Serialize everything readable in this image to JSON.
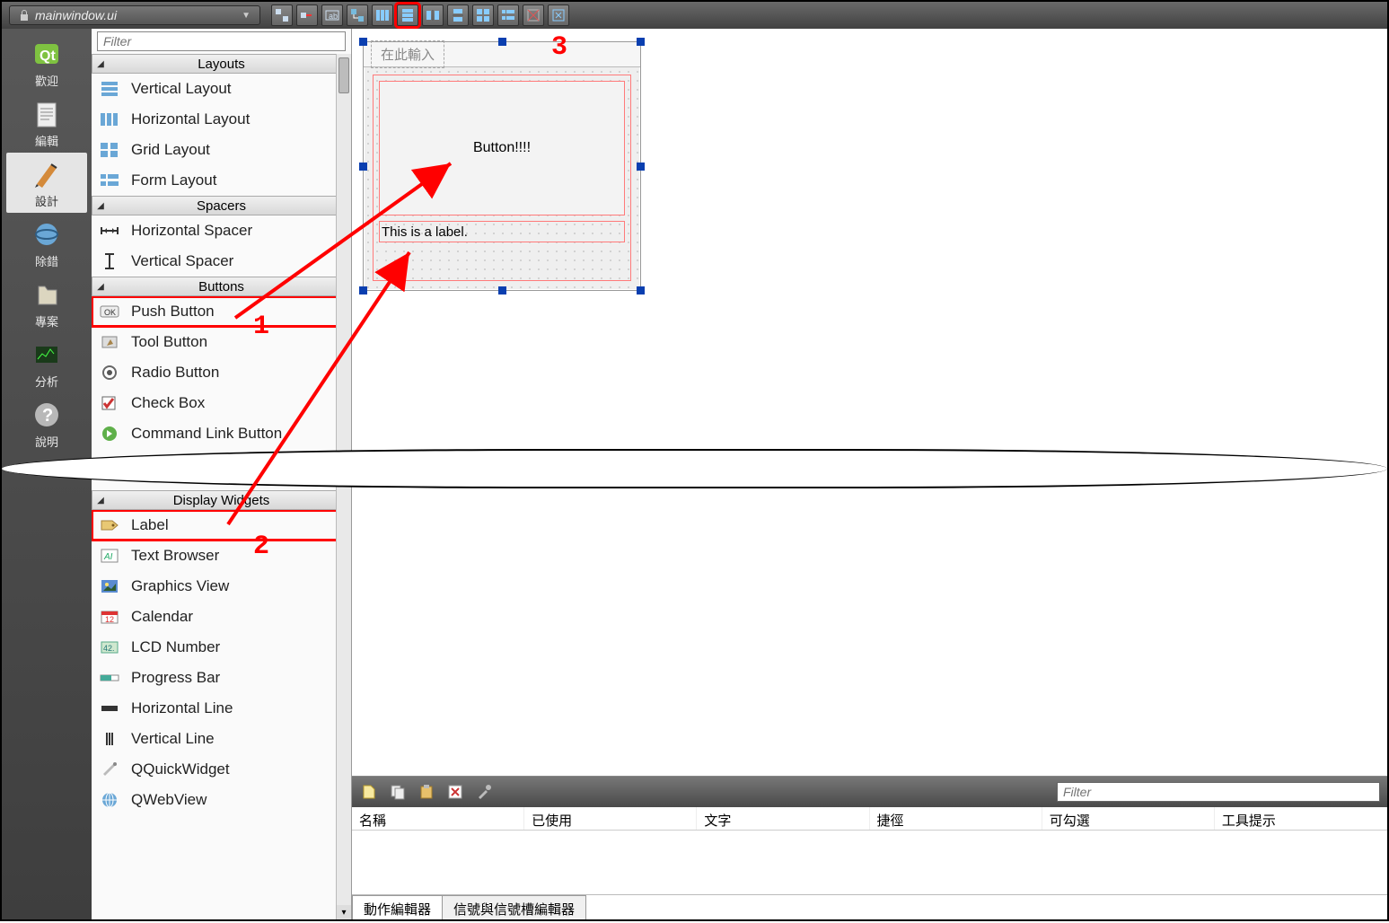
{
  "toolbar": {
    "filename": "mainwindow.ui",
    "buttons": [
      "edit-widgets",
      "edit-signals",
      "edit-buddies",
      "edit-tab-order",
      "layout-h",
      "layout-v",
      "layout-h-splitter",
      "layout-v-splitter",
      "layout-grid",
      "layout-form",
      "break-layout",
      "adjust-size"
    ]
  },
  "modes": [
    {
      "key": "welcome",
      "label": "歡迎"
    },
    {
      "key": "edit",
      "label": "編輯"
    },
    {
      "key": "design",
      "label": "設計",
      "active": true
    },
    {
      "key": "debug",
      "label": "除錯"
    },
    {
      "key": "projects",
      "label": "專案"
    },
    {
      "key": "analyze",
      "label": "分析"
    },
    {
      "key": "help",
      "label": "說明"
    }
  ],
  "widgetbox": {
    "filter_placeholder": "Filter",
    "groups_top": [
      {
        "title": "Layouts",
        "arrow": "◢",
        "items": [
          {
            "icon": "vlayout",
            "label": "Vertical Layout"
          },
          {
            "icon": "hlayout",
            "label": "Horizontal Layout"
          },
          {
            "icon": "grid",
            "label": "Grid Layout"
          },
          {
            "icon": "form",
            "label": "Form Layout"
          }
        ]
      },
      {
        "title": "Spacers",
        "arrow": "◢",
        "items": [
          {
            "icon": "hspacer",
            "label": "Horizontal Spacer"
          },
          {
            "icon": "vspacer",
            "label": "Vertical Spacer"
          }
        ]
      },
      {
        "title": "Buttons",
        "arrow": "◢",
        "items": [
          {
            "icon": "pushbtn",
            "label": "Push Button",
            "boxed": true
          },
          {
            "icon": "toolbtn",
            "label": "Tool Button"
          },
          {
            "icon": "radio",
            "label": "Radio Button"
          },
          {
            "icon": "check",
            "label": "Check Box"
          },
          {
            "icon": "cmdlink",
            "label": "Command Link Button"
          }
        ]
      }
    ],
    "groups_bottom": [
      {
        "title": "Display Widgets",
        "arrow": "◢",
        "items": [
          {
            "icon": "label",
            "label": "Label",
            "boxed": true
          },
          {
            "icon": "textbrowser",
            "label": "Text Browser"
          },
          {
            "icon": "graphics",
            "label": "Graphics View"
          },
          {
            "icon": "calendar",
            "label": "Calendar"
          },
          {
            "icon": "lcd",
            "label": "LCD Number"
          },
          {
            "icon": "progress",
            "label": "Progress Bar"
          },
          {
            "icon": "hline",
            "label": "Horizontal Line"
          },
          {
            "icon": "vline",
            "label": "Vertical Line"
          },
          {
            "icon": "qquick",
            "label": "QQuickWidget"
          },
          {
            "icon": "qweb",
            "label": "QWebView"
          }
        ]
      }
    ]
  },
  "form": {
    "menu_ghost": "在此輸入",
    "button_text": "Button!!!!",
    "label_text": "This is a label."
  },
  "action_panel": {
    "filter_placeholder": "Filter",
    "headers": [
      "名稱",
      "已使用",
      "文字",
      "捷徑",
      "可勾選",
      "工具提示"
    ],
    "tabs": [
      {
        "label": "動作編輯器",
        "active": true
      },
      {
        "label": "信號與信號槽編輯器",
        "active": false
      }
    ]
  },
  "annotations": {
    "n1": "1",
    "n2": "2",
    "n3": "3"
  }
}
